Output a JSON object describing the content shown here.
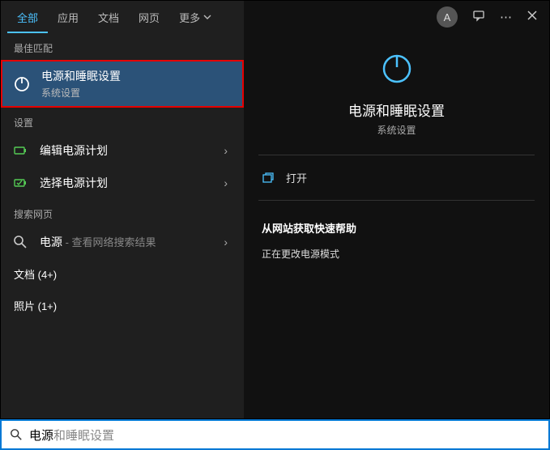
{
  "tabs": {
    "all": "全部",
    "apps": "应用",
    "docs": "文档",
    "web": "网页",
    "more": "更多"
  },
  "sections": {
    "best_match": "最佳匹配",
    "settings": "设置",
    "search_web": "搜索网页"
  },
  "best_match": {
    "title": "电源和睡眠设置",
    "subtitle": "系统设置"
  },
  "settings_items": [
    {
      "title": "编辑电源计划"
    },
    {
      "title": "选择电源计划"
    }
  ],
  "web_search": {
    "prefix": "电源",
    "suffix": " - 查看网络搜索结果"
  },
  "more_results": {
    "docs": "文档 (4+)",
    "photos": "照片 (1+)"
  },
  "header": {
    "avatar_initial": "A"
  },
  "detail": {
    "title": "电源和睡眠设置",
    "subtitle": "系统设置",
    "open_label": "打开",
    "help_title": "从网站获取快速帮助",
    "help_link": "正在更改电源模式"
  },
  "search": {
    "typed": "电源",
    "hint": "和睡眠设置"
  }
}
